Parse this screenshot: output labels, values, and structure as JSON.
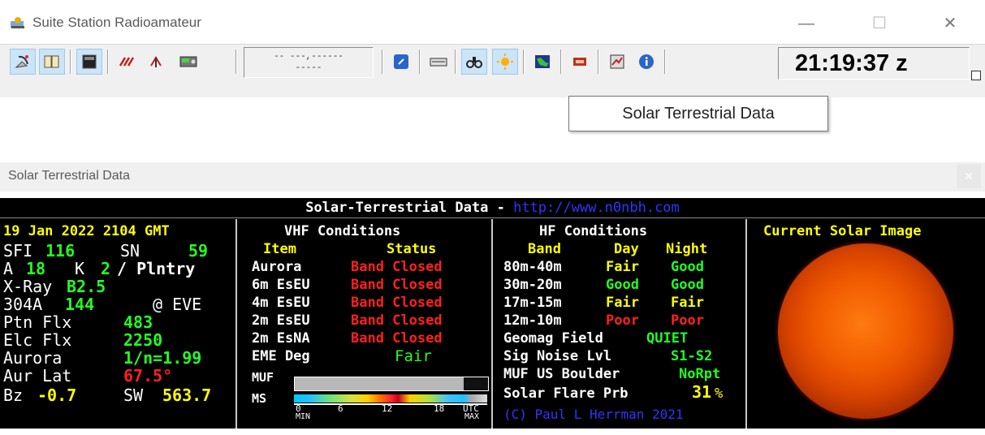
{
  "window": {
    "title": "Suite Station Radioamateur",
    "minimize_glyph": "—",
    "maximize_glyph": "☐",
    "close_glyph": "✕"
  },
  "toolbar": {
    "grid_line1": "-- ---,------",
    "grid_line2": "-----",
    "clock": "21:19:37 z"
  },
  "tooltip": {
    "text": "Solar Terrestrial Data"
  },
  "panel": {
    "title": "Solar Terrestrial Data",
    "close_glyph": "✕"
  },
  "solar": {
    "header_title": "Solar-Terrestrial Data - ",
    "header_url": "http://www.n0nbh.com",
    "date": "19 Jan 2022 2104 GMT",
    "left": {
      "sfi_label": "SFI",
      "sfi_value": "116",
      "sn_label": "SN",
      "sn_value": "59",
      "a_label": "A",
      "a_value": "18",
      "k_label": "K",
      "k_value": "2",
      "k_suffix": "/ Plntry",
      "xray_label": "X-Ray",
      "xray_value": "B2.5",
      "f304_label": "304A",
      "f304_value": "144",
      "f304_suffix": "@ EVE",
      "ptn_label": "Ptn Flx",
      "ptn_value": "483",
      "elc_label": "Elc Flx",
      "elc_value": "2250",
      "aurora_label": "Aurora",
      "aurora_value": "1/n=1.99",
      "aurlat_label": "Aur Lat",
      "aurlat_value": "67.5°",
      "bz_label": "Bz",
      "bz_value": "-0.7",
      "sw_label": "SW",
      "sw_value": "563.7"
    },
    "vhf": {
      "title": "VHF Conditions",
      "item_header": "Item",
      "status_header": "Status",
      "rows": [
        {
          "item": "Aurora",
          "status": "Band Closed"
        },
        {
          "item": "6m EsEU",
          "status": "Band Closed"
        },
        {
          "item": "4m EsEU",
          "status": "Band Closed"
        },
        {
          "item": "2m EsEU",
          "status": "Band Closed"
        },
        {
          "item": "2m EsNA",
          "status": "Band Closed"
        }
      ],
      "eme_label": "EME Deg",
      "eme_value": "Fair",
      "muf_label": "MUF",
      "ms_label": "MS",
      "scale_ticks": [
        "0",
        "6",
        "12",
        "18",
        "UTC"
      ],
      "scale_min": "MIN",
      "scale_max": "MAX"
    },
    "hf": {
      "title": "HF Conditions",
      "band_header": "Band",
      "day_header": "Day",
      "night_header": "Night",
      "rows": [
        {
          "band": "80m-40m",
          "day": "Fair",
          "night": "Good"
        },
        {
          "band": "30m-20m",
          "day": "Good",
          "night": "Good"
        },
        {
          "band": "17m-15m",
          "day": "Fair",
          "night": "Fair"
        },
        {
          "band": "12m-10m",
          "day": "Poor",
          "night": "Poor"
        }
      ],
      "geomag_label": "Geomag Field",
      "geomag_value": "QUIET",
      "signoise_label": "Sig Noise Lvl",
      "signoise_value": "S1-S2",
      "muf_label": "MUF US Boulder",
      "muf_value": "NoRpt",
      "flare_label": "Solar Flare Prb",
      "flare_value": "31",
      "flare_unit": "%",
      "copyright": "(C) Paul L Herrman 2021"
    },
    "image_title": "Current Solar Image"
  },
  "colors": {
    "white": "#ffffff",
    "yellow": "#ffff00",
    "green": "#22ff22",
    "red": "#ff2020",
    "blue": "#3333ff"
  }
}
